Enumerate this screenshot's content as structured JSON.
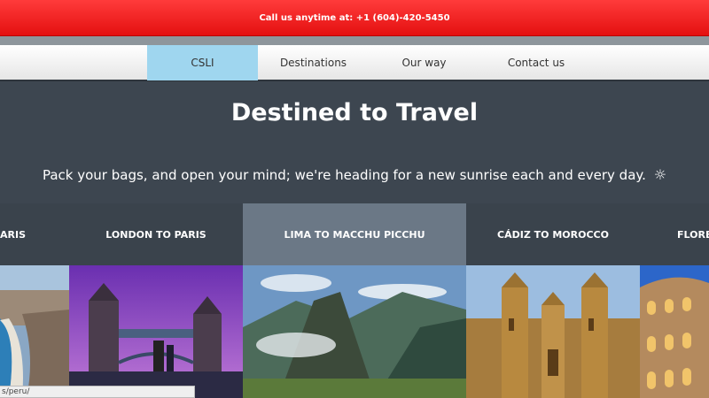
{
  "topbar": {
    "text": "Call us anytime at: +1 (604)-420-5450"
  },
  "nav": {
    "items": [
      {
        "label": "CSLI",
        "active": true
      },
      {
        "label": "Destinations",
        "active": false
      },
      {
        "label": "Our way",
        "active": false
      },
      {
        "label": "Contact us",
        "active": false
      }
    ]
  },
  "hero": {
    "title": "Destined to Travel",
    "tagline": "Pack your bags, and open your mind; we're heading for a new sunrise each and every day."
  },
  "cards": [
    {
      "label": "ARIS"
    },
    {
      "label": "LONDON TO PARIS"
    },
    {
      "label": "LIMA TO MACCHU PICCHU"
    },
    {
      "label": "CÁDIZ TO MOROCCO"
    },
    {
      "label": "FLORE"
    }
  ],
  "status_bar": {
    "url": "s/peru/"
  },
  "colors": {
    "topbar": "#e41010",
    "nav_active": "#9fd6ef",
    "page_bg": "#3d4650",
    "card_head": "#3a434c",
    "card_head_active": "#6b7886"
  },
  "icons": {
    "sun": "sun-icon"
  }
}
